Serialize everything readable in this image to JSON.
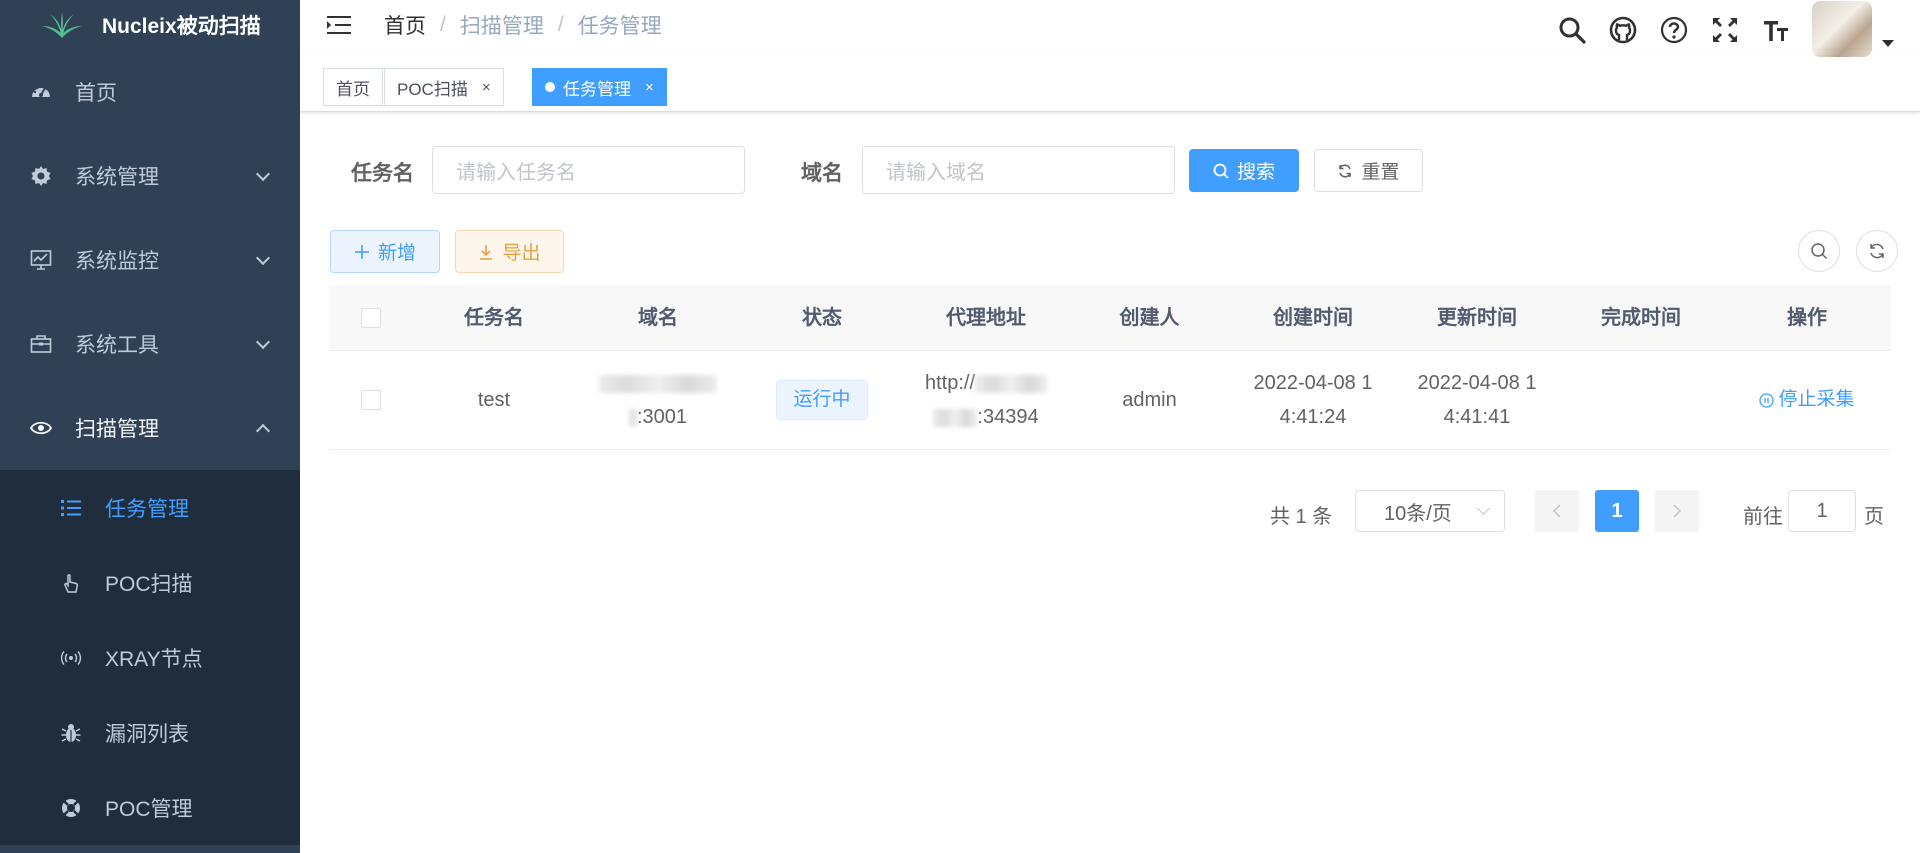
{
  "app": {
    "title": "Nucleix被动扫描"
  },
  "sidebar": {
    "items": [
      {
        "label": "首页",
        "icon": "dashboard-icon"
      },
      {
        "label": "系统管理",
        "icon": "gear-icon"
      },
      {
        "label": "系统监控",
        "icon": "monitor-icon"
      },
      {
        "label": "系统工具",
        "icon": "toolbox-icon"
      },
      {
        "label": "扫描管理",
        "icon": "eye-icon"
      }
    ],
    "sub_items": [
      {
        "label": "任务管理",
        "icon": "list-icon",
        "active": true
      },
      {
        "label": "POC扫描",
        "icon": "pointer-hand-icon"
      },
      {
        "label": "XRAY节点",
        "icon": "radio-icon"
      },
      {
        "label": "漏洞列表",
        "icon": "bug-icon"
      },
      {
        "label": "POC管理",
        "icon": "lifebuoy-icon"
      }
    ]
  },
  "breadcrumb": [
    "首页",
    "扫描管理",
    "任务管理"
  ],
  "tags": [
    {
      "label": "首页"
    },
    {
      "label": "POC扫描",
      "close": "×"
    },
    {
      "label": "任务管理",
      "close": "×",
      "active": true
    }
  ],
  "search": {
    "task_label": "任务名",
    "task_placeholder": "请输入任务名",
    "domain_label": "域名",
    "domain_placeholder": "请输入域名",
    "search_btn": "搜索",
    "reset_btn": "重置"
  },
  "toolbar": {
    "add_btn": "新增",
    "export_btn": "导出"
  },
  "table": {
    "columns": [
      "任务名",
      "域名",
      "状态",
      "代理地址",
      "创建人",
      "创建时间",
      "更新时间",
      "完成时间",
      "操作"
    ],
    "rows": [
      {
        "task_name": "test",
        "domain_line2": ":3001",
        "status": "运行中",
        "proxy_line1": "http://",
        "proxy_line2": ":34394",
        "creator": "admin",
        "created_line1": "2022-04-08 1",
        "created_line2": "4:41:24",
        "updated_line1": "2022-04-08 1",
        "updated_line2": "4:41:41",
        "finished": "",
        "action": "停止采集"
      }
    ]
  },
  "pagination": {
    "total": "共 1 条",
    "page_size": "10条/页",
    "current_page": "1",
    "goto_label": "前往",
    "goto_value": "1",
    "page_suffix": "页"
  },
  "colors": {
    "sidebar_bg": "#304156",
    "submenu_bg": "#1f2d3d",
    "primary": "#409eff",
    "warning": "#e6a23c"
  }
}
